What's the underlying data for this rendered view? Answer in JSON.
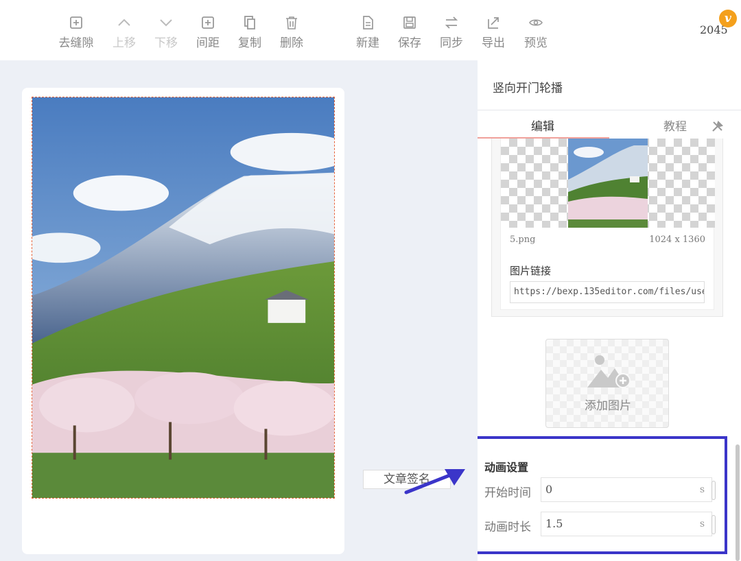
{
  "toolbar": {
    "items": [
      {
        "label": "去缝隙",
        "icon": "plus-square-icon",
        "disabled": false
      },
      {
        "label": "上移",
        "icon": "chevron-up-icon",
        "disabled": true
      },
      {
        "label": "下移",
        "icon": "chevron-down-icon",
        "disabled": true
      },
      {
        "label": "间距",
        "icon": "spacing-icon",
        "disabled": false
      },
      {
        "label": "复制",
        "icon": "copy-icon",
        "disabled": false
      },
      {
        "label": "删除",
        "icon": "trash-icon",
        "disabled": false
      },
      {
        "label": "新建",
        "icon": "new-file-icon",
        "disabled": false
      },
      {
        "label": "保存",
        "icon": "save-icon",
        "disabled": false
      },
      {
        "label": "同步",
        "icon": "sync-icon",
        "disabled": false
      },
      {
        "label": "导出",
        "icon": "export-icon",
        "disabled": false
      },
      {
        "label": "预览",
        "icon": "eye-icon",
        "disabled": false
      }
    ],
    "count": "2045",
    "badge": "v",
    "badge_color": "#f4a01c"
  },
  "canvas": {
    "signature_label": "文章签名",
    "selection_color": "#e7643b"
  },
  "panel": {
    "title": "竖向开门轮播",
    "tabs": {
      "edit": "编辑",
      "tutorial": "教程"
    },
    "image": {
      "filename": "5.png",
      "size": "1024 x 1360",
      "link_label": "图片链接",
      "link_value": "https://bexp.135editor.com/files/use"
    },
    "add_image_label": "添加图片",
    "animation": {
      "title": "动画设置",
      "start_label": "开始时间",
      "start_value": "0",
      "duration_label": "动画时长",
      "duration_value": "1.5",
      "unit": "s",
      "highlight_color": "#3b35c9"
    }
  }
}
